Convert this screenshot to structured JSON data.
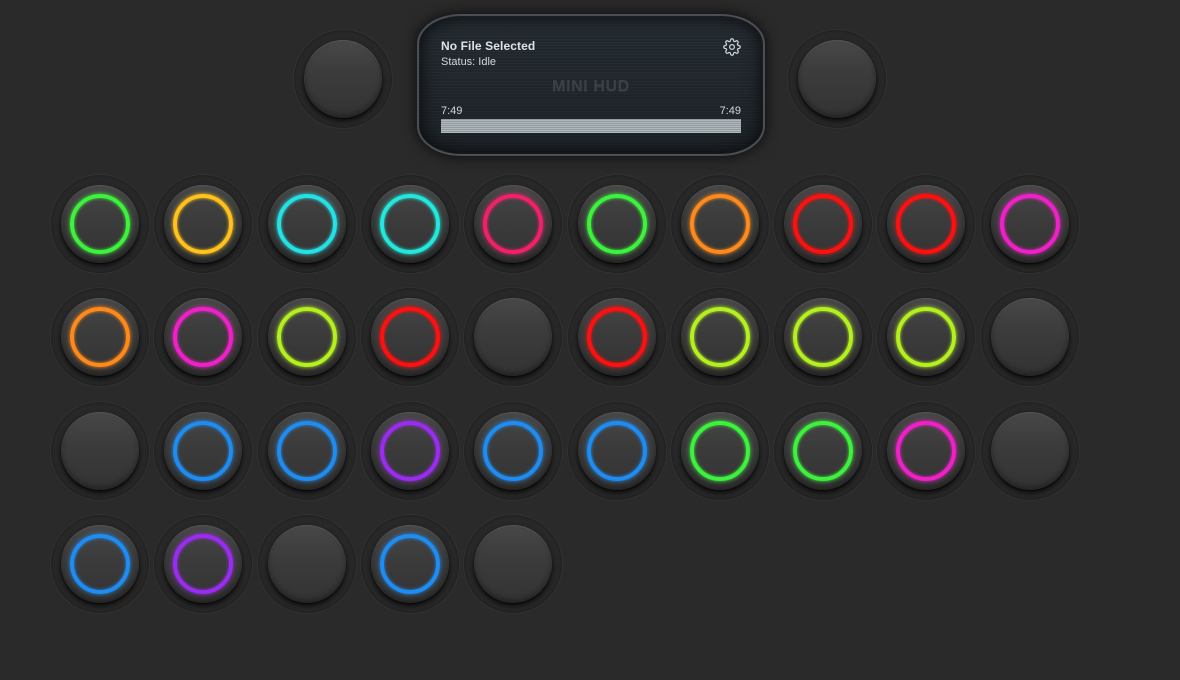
{
  "hud": {
    "title": "No File Selected",
    "status": "Status: Idle",
    "logo": "MINI HUD",
    "time_elapsed": "7:49",
    "time_total": "7:49",
    "progress_fraction": 1.0,
    "icon": "gear-icon"
  },
  "transport": {
    "left_button": "blank-knob",
    "right_button": "blank-knob"
  },
  "pads": [
    {
      "ring": "#3cf23c"
    },
    {
      "ring": "#ffc21a"
    },
    {
      "ring": "#22e2e6"
    },
    {
      "ring": "#22e8dc"
    },
    {
      "ring": "#f0206a"
    },
    {
      "ring": "#3cf23c"
    },
    {
      "ring": "#ff8a1a"
    },
    {
      "ring": "#ff1010"
    },
    {
      "ring": "#ff1010"
    },
    {
      "ring": "#f020c8"
    },
    {
      "ring": "#ff8a1a"
    },
    {
      "ring": "#f020c8"
    },
    {
      "ring": "#b4f01e"
    },
    {
      "ring": "#ff1010"
    },
    {
      "ring": null
    },
    {
      "ring": "#ff1010"
    },
    {
      "ring": "#b4f01e"
    },
    {
      "ring": "#b4f01e"
    },
    {
      "ring": "#b4f01e"
    },
    {
      "ring": null
    },
    {
      "ring": null
    },
    {
      "ring": "#1e8cf0"
    },
    {
      "ring": "#1e8cf0"
    },
    {
      "ring": "#9a2cf0"
    },
    {
      "ring": "#1e8cf0"
    },
    {
      "ring": "#1e8cf0"
    },
    {
      "ring": "#3cf23c"
    },
    {
      "ring": "#3cf23c"
    },
    {
      "ring": "#f020c8"
    },
    {
      "ring": null
    },
    {
      "ring": "#1e8cf0"
    },
    {
      "ring": "#9a2cf0"
    },
    {
      "ring": null
    },
    {
      "ring": "#1e8cf0"
    },
    {
      "ring": null
    }
  ]
}
